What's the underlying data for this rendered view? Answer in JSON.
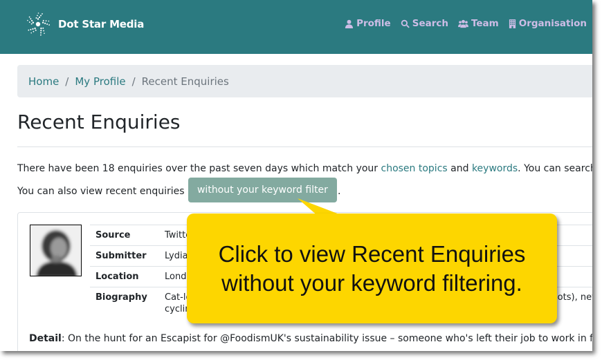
{
  "navbar": {
    "brand_name": "Dot Star Media",
    "brand_icon": "dot-star-logo-icon",
    "items": [
      {
        "label": "Profile",
        "icon": "user-icon"
      },
      {
        "label": "Search",
        "icon": "search-icon"
      },
      {
        "label": "Team",
        "icon": "users-icon"
      },
      {
        "label": "Organisation",
        "icon": "building-icon"
      }
    ]
  },
  "breadcrumb": {
    "items": [
      {
        "label": "Home",
        "link": true
      },
      {
        "label": "My Profile",
        "link": true
      },
      {
        "label": "Recent Enquiries",
        "link": false
      }
    ],
    "separator": "/"
  },
  "page": {
    "title": "Recent Enquiries",
    "intro_part1": "There have been 18 enquiries over the past seven days which match your ",
    "link_topics": "chosen topics",
    "intro_and": " and ",
    "link_keywords": "keywords",
    "intro_part2": ". You can search",
    "line2_prefix": "You can also view recent enquiries ",
    "filter_button": "without your keyword filter",
    "line2_suffix": "."
  },
  "enquiry": {
    "avatar_alt": "submitter-photo",
    "fields": [
      {
        "key": "Source",
        "value": "Twitte"
      },
      {
        "key": "Submitter",
        "value": "Lydia."
      },
      {
        "key": "Location",
        "value": "Londo"
      },
      {
        "key": "Biography",
        "value": "Cat-lo",
        "value_line2": "cycling",
        "value_right": "(lots), net"
      }
    ],
    "detail_label": "Detail",
    "detail_text": ": On the hunt for an Escapist for @FoodismUK's sustainability issue – someone who's left their job to work in f"
  },
  "callout": {
    "line1": "Click to view Recent Enquiries",
    "line2": "without your keyword filtering.",
    "color": "#fdd600"
  },
  "colors": {
    "navbar": "#2b7a80",
    "nav_text": "#cdbde6",
    "link": "#2b7a80",
    "filter_button": "#83aaa0"
  }
}
